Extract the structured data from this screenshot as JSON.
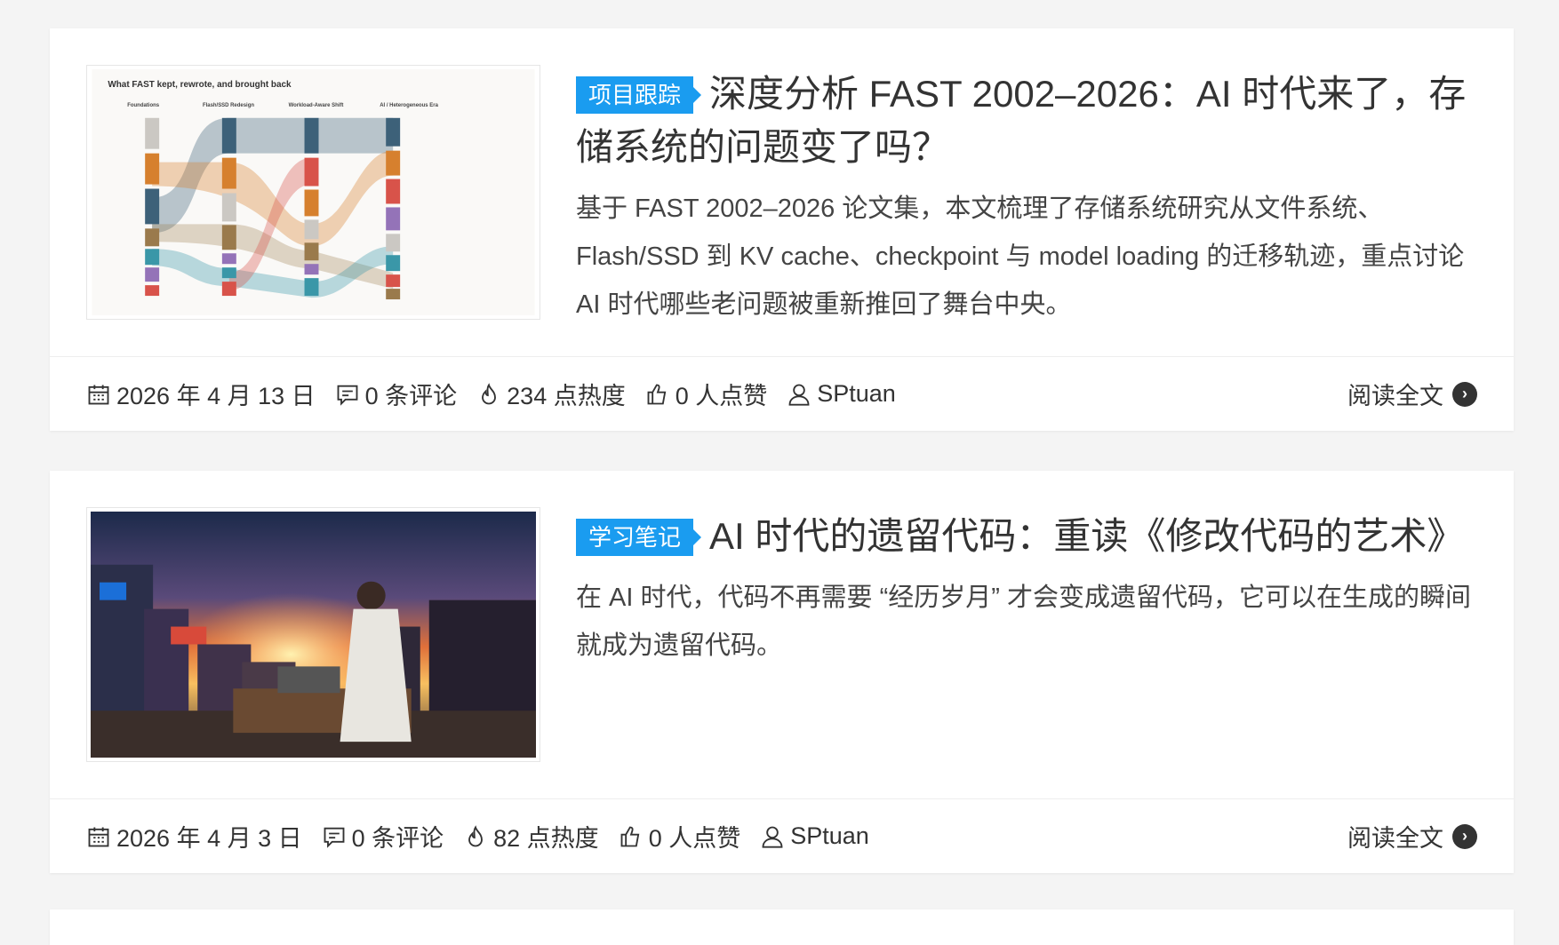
{
  "posts": [
    {
      "tag": "项目跟踪",
      "title": "深度分析 FAST 2002–2026：AI 时代来了，存储系统的问题变了吗？",
      "description": "基于 FAST 2002–2026 论文集，本文梳理了存储系统研究从文件系统、Flash/SSD 到 KV cache、checkpoint 与 model loading 的迁移轨迹，重点讨论 AI 时代哪些老问题被重新推回了舞台中央。",
      "thumbnail": {
        "title": "What FAST kept, rewrote, and brought back",
        "phases": [
          "Foundations",
          "Flash/SSD Redesign",
          "Workload-Aware Shift",
          "AI / Heterogeneous Era"
        ]
      },
      "date": "2026 年 4 月 13 日",
      "comments": "0 条评论",
      "heat": "234 点热度",
      "likes": "0 人点赞",
      "author": "SPtuan",
      "read_more": "阅读全文"
    },
    {
      "tag": "学习笔记",
      "title": "AI 时代的遗留代码：重读《修改代码的艺术》",
      "description": "在 AI 时代，代码不再需要 “经历岁月” 才会变成遗留代码，它可以在生成的瞬间就成为遗留代码。",
      "date": "2026 年 4 月 3 日",
      "comments": "0 条评论",
      "heat": "82 点热度",
      "likes": "0 人点赞",
      "author": "SPtuan",
      "read_more": "阅读全文"
    }
  ]
}
